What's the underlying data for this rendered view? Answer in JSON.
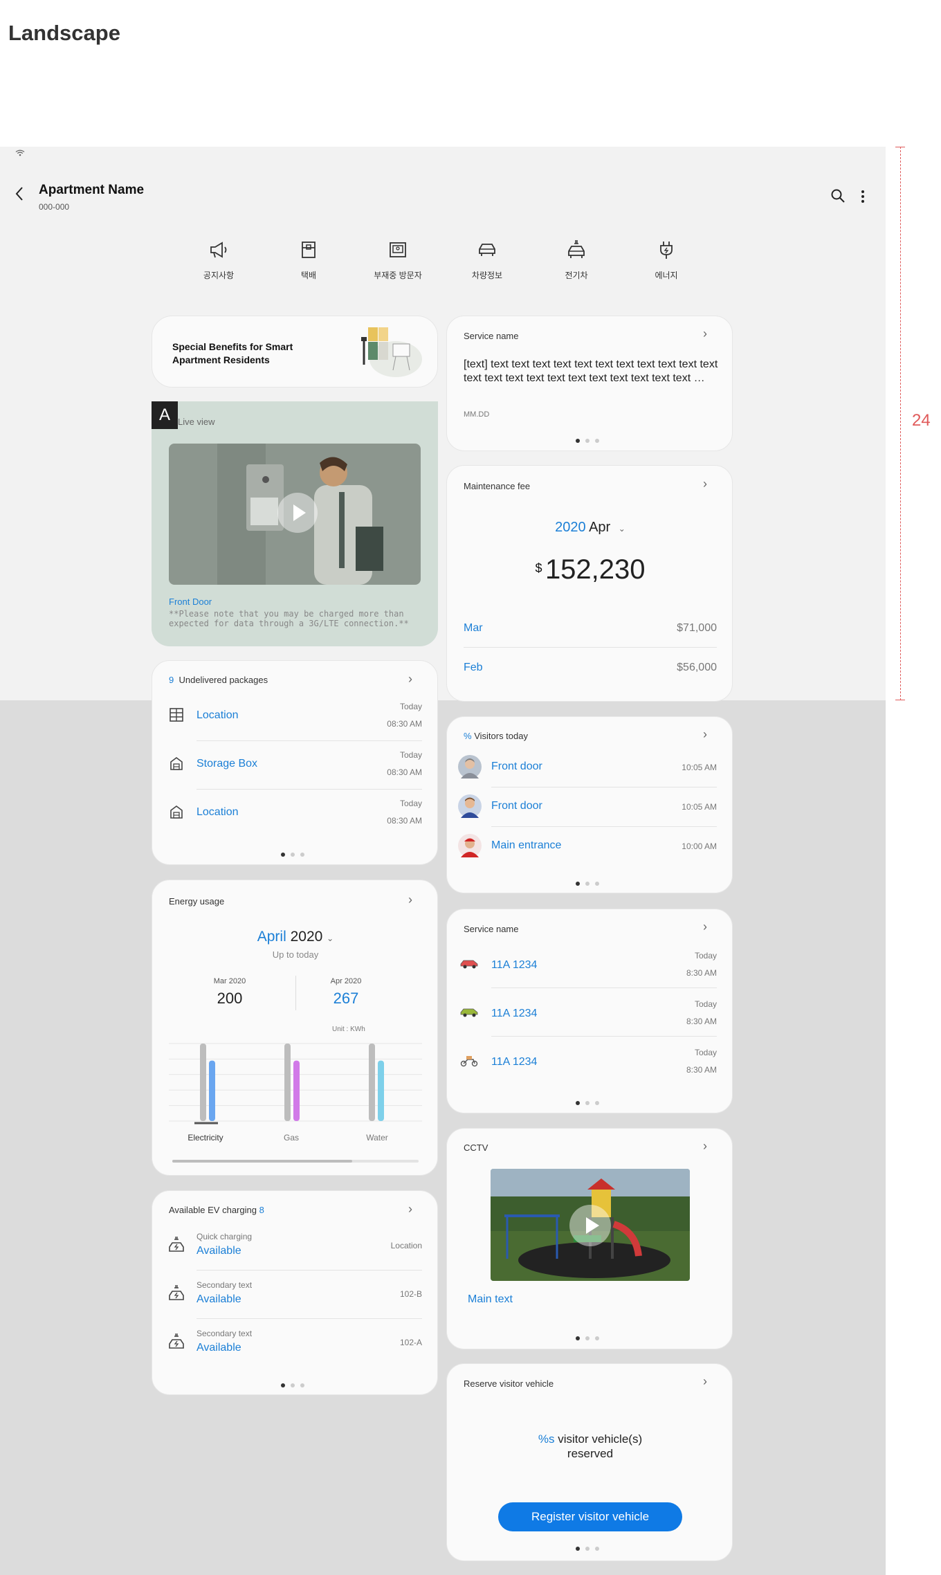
{
  "page_title": "Landscape",
  "ruler_value": "24",
  "header": {
    "title": "Apartment Name",
    "subtitle": "000-000"
  },
  "quick_menu": [
    {
      "label": "공지사항",
      "icon": "megaphone-icon"
    },
    {
      "label": "택배",
      "icon": "parcel-icon"
    },
    {
      "label": "부재중 방문자",
      "icon": "missed-visitor-icon"
    },
    {
      "label": "차량정보",
      "icon": "car-icon"
    },
    {
      "label": "전기차",
      "icon": "ev-car-icon"
    },
    {
      "label": "에너지",
      "icon": "plug-icon"
    }
  ],
  "benefits": {
    "text": "Special Benefits for Smart Apartment Residents"
  },
  "live_view": {
    "badge": "A",
    "title": "Live view",
    "caption": "Front Door",
    "note": "**Please note that you may be charged more than expected for data through a 3G/LTE connection.**"
  },
  "packages": {
    "count": "9",
    "title": "Undelivered packages",
    "rows": [
      {
        "label": "Location",
        "day": "Today",
        "time": "08:30 AM"
      },
      {
        "label": "Storage Box",
        "day": "Today",
        "time": "08:30 AM"
      },
      {
        "label": "Location",
        "day": "Today",
        "time": "08:30 AM"
      }
    ]
  },
  "energy": {
    "title": "Energy usage",
    "month": "April",
    "year": "2020",
    "caption": "Up to today",
    "prev_label": "Mar 2020",
    "prev_value": "200",
    "curr_label": "Apr 2020",
    "curr_value": "267",
    "unit": "Unit : KWh",
    "tabs": [
      "Electricity",
      "Gas",
      "Water"
    ]
  },
  "chart_data": {
    "type": "bar",
    "categories": [
      "Electricity",
      "Gas",
      "Water"
    ],
    "series": [
      {
        "values": [
          100,
          100,
          100
        ]
      },
      {
        "values": [
          78,
          78,
          78
        ]
      }
    ],
    "colors": [
      "#bdbdbd",
      "#6aa6f0",
      "#d17ae8",
      "#7ed0ea"
    ]
  },
  "ev": {
    "title": "Available EV charging",
    "count": "8",
    "rows": [
      {
        "secondary": "Quick charging",
        "status": "Available",
        "location": "Location"
      },
      {
        "secondary": "Secondary text",
        "status": "Available",
        "location": "102-B"
      },
      {
        "secondary": "Secondary text",
        "status": "Available",
        "location": "102-A"
      }
    ]
  },
  "service_notice": {
    "title": "Service name",
    "body": "[text] text text text text text text text text text text text text text text text text text text text text text text …",
    "date": "MM.DD"
  },
  "maintenance": {
    "title": "Maintenance fee",
    "year": "2020",
    "month": "Apr",
    "currency": "$",
    "amount": "152,230",
    "rows": [
      {
        "month": "Mar",
        "amount": "$71,000"
      },
      {
        "month": "Feb",
        "amount": "$56,000"
      }
    ]
  },
  "visitors": {
    "prefix": "%",
    "title": "Visitors today",
    "rows": [
      {
        "label": "Front door",
        "time": "10:05 AM"
      },
      {
        "label": "Front door",
        "time": "10:05 AM"
      },
      {
        "label": "Main entrance",
        "time": "10:00 AM"
      }
    ]
  },
  "vehicles": {
    "title": "Service name",
    "rows": [
      {
        "plate": "11A 1234",
        "day": "Today",
        "time": "8:30 AM",
        "color": "#e05050"
      },
      {
        "plate": "11A 1234",
        "day": "Today",
        "time": "8:30 AM",
        "color": "#9ab83a"
      },
      {
        "plate": "11A 1234",
        "day": "Today",
        "time": "8:30 AM",
        "color": "#e0a060"
      }
    ]
  },
  "cctv": {
    "title": "CCTV",
    "main_text": "Main text"
  },
  "reserve": {
    "title": "Reserve visitor vehicle",
    "prefix": "%s",
    "text": "visitor vehicle(s) reserved",
    "button": "Register visitor vehicle"
  }
}
